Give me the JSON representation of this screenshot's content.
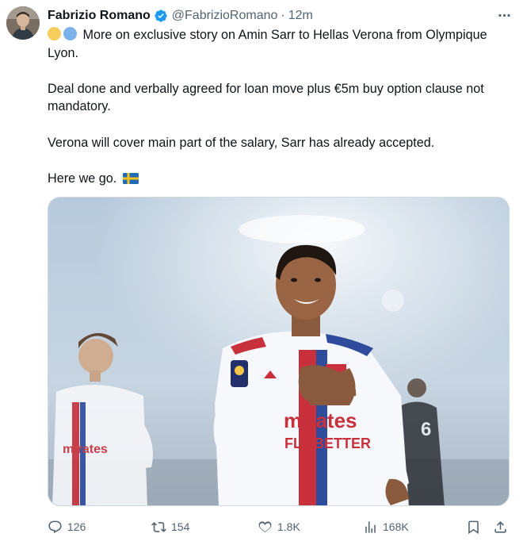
{
  "author": {
    "name": "Fabrizio Romano",
    "handle": "@FabrizioRomano",
    "separator": "·",
    "time": "12m"
  },
  "tweet": {
    "line1": "More on exclusive story on Amin Sarr to Hellas Verona from Olympique Lyon.",
    "line2": "Deal done and verbally agreed for loan move plus €5m buy option clause not mandatory.",
    "line3": "Verona will cover main part of the salary, Sarr has already accepted.",
    "line4": "Here we go."
  },
  "media": {
    "main_sponsor_top": "mirates",
    "main_sponsor_bottom": "FLY BETTER",
    "left_sponsor": "mirates",
    "opponent_number": "6"
  },
  "actions": {
    "replies": "126",
    "reposts": "154",
    "likes": "1.8K",
    "views": "168K"
  },
  "colors": {
    "text": "#0f1419",
    "secondary": "#536471",
    "verified": "#1d9bf0",
    "border": "#cfd9de"
  }
}
